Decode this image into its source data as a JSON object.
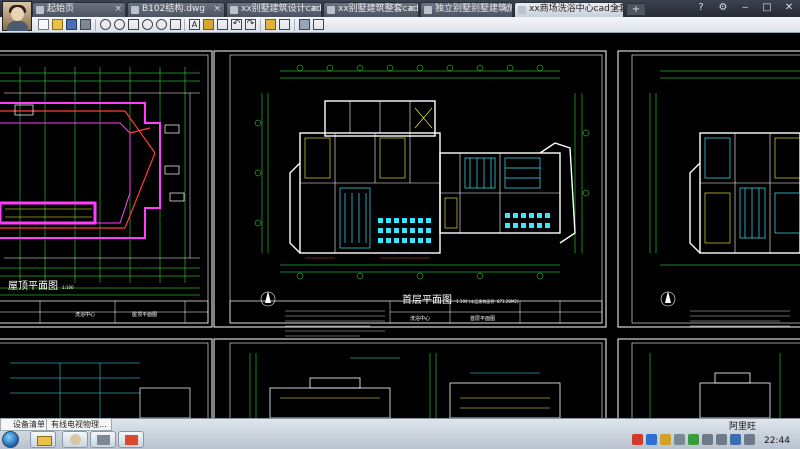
{
  "tabs": [
    {
      "label": "起始页",
      "active": false
    },
    {
      "label": "B102结构.dwg",
      "active": false
    },
    {
      "label": "xx别墅建筑设计cad施...",
      "active": false
    },
    {
      "label": "xx别墅建筑整套cad施...",
      "active": false
    },
    {
      "label": "独立别墅别墅建筑施工...",
      "active": false
    },
    {
      "label": "xx商场洗浴中心cad全套设计...",
      "active": true
    }
  ],
  "new_tab_label": "+",
  "sheets": {
    "roof_plan_title": "屋顶平面图",
    "roof_plan_scale": "1:100",
    "roof_titleblock_project": "洗浴中心",
    "roof_titleblock_drawing": "屋顶平面图",
    "ground_plan_title": "首层平面图",
    "ground_plan_scale": "1:100  (本层建筑面积: 871.28M2)",
    "ground_titleblock_project": "洗浴中心",
    "ground_titleblock_drawing": "首层平面图"
  },
  "taskbar": {
    "popup_label": "设备清单",
    "popup2_label": "有线电视物理...",
    "tray_text": "阿里旺",
    "clock": "22:44"
  },
  "colors": {
    "cad_background": "#000000",
    "line_white": "#ffffff",
    "line_green": "#3cff3c",
    "line_cyan": "#3ce6ff",
    "line_yellow": "#ffff3c",
    "line_magenta": "#ff3cff",
    "line_red": "#ff3c3c",
    "active_tab": "#e8ecf2"
  }
}
